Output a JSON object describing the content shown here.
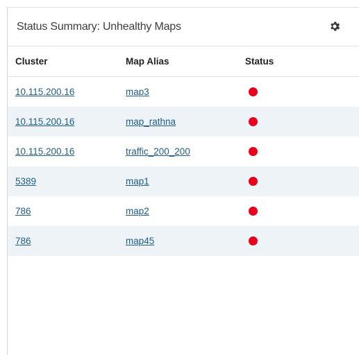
{
  "panel": {
    "title": "Status Summary: Unhealthy Maps",
    "settings_icon": "gear-icon"
  },
  "table": {
    "headers": [
      "Cluster",
      "Map Alias",
      "Status"
    ],
    "rows": [
      {
        "cluster": "10.115.200.16",
        "alias": "map3",
        "status": "unhealthy"
      },
      {
        "cluster": "10.115.200.16",
        "alias": "map_rathna",
        "status": "unhealthy"
      },
      {
        "cluster": "10.115.200.16",
        "alias": "traffic_200_200",
        "status": "unhealthy"
      },
      {
        "cluster": "5389",
        "alias": "map1",
        "status": "unhealthy"
      },
      {
        "cluster": "786",
        "alias": "map2",
        "status": "unhealthy"
      },
      {
        "cluster": "786",
        "alias": "map45",
        "status": "unhealthy"
      }
    ]
  },
  "colors": {
    "status_unhealthy": "#e8001c",
    "link": "#1e5e86",
    "row_alt": "#eef3f7"
  }
}
